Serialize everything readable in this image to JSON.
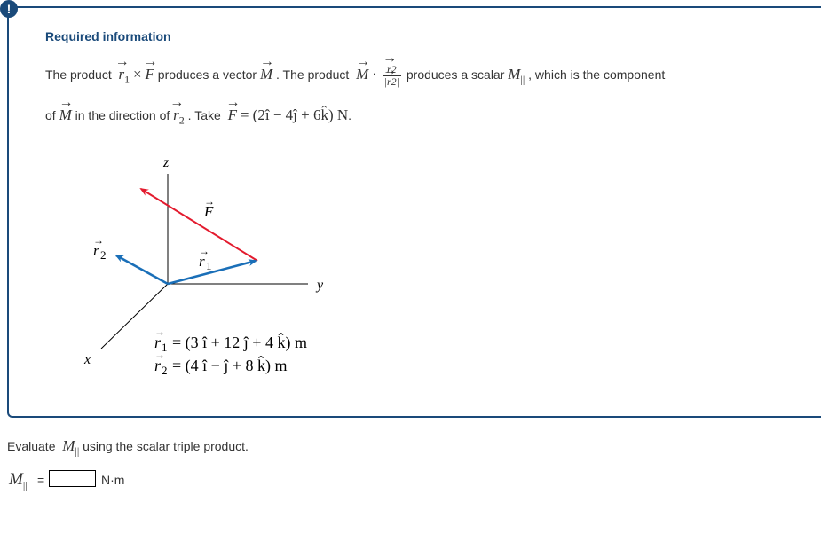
{
  "alert_icon": "!",
  "required_title": "Required information",
  "intro": {
    "t1": "The product",
    "t2": "produces a vector",
    "t3": ". The product",
    "t4": "produces a scalar",
    "t5": ", which is the component",
    "t6": "of",
    "t7": "in the direction of",
    "t8": ". Take",
    "force_expr": "= (2î − 4ĵ + 6k̂) N",
    "period": "."
  },
  "symbols": {
    "r": "r",
    "F": "F",
    "M": "M",
    "times": "×",
    "dot": "·",
    "sub1": "1",
    "sub2": "2",
    "par": "||"
  },
  "diagram": {
    "axis_z": "z",
    "axis_y": "y",
    "axis_x": "x",
    "label_F": "F",
    "label_r1": "r",
    "label_r2": "r",
    "eq_r1": "= (3 î + 12 ĵ + 4 k̂) m",
    "eq_r2": "= (4 î − ĵ + 8 k̂) m",
    "colors": {
      "force": "#e31b2e",
      "position": "#1a6fb8",
      "axis": "#000000"
    }
  },
  "question": {
    "pre": "Evaluate",
    "post": "using the scalar triple product."
  },
  "answer": {
    "equals": "=",
    "value": "",
    "unit": "N·m"
  }
}
